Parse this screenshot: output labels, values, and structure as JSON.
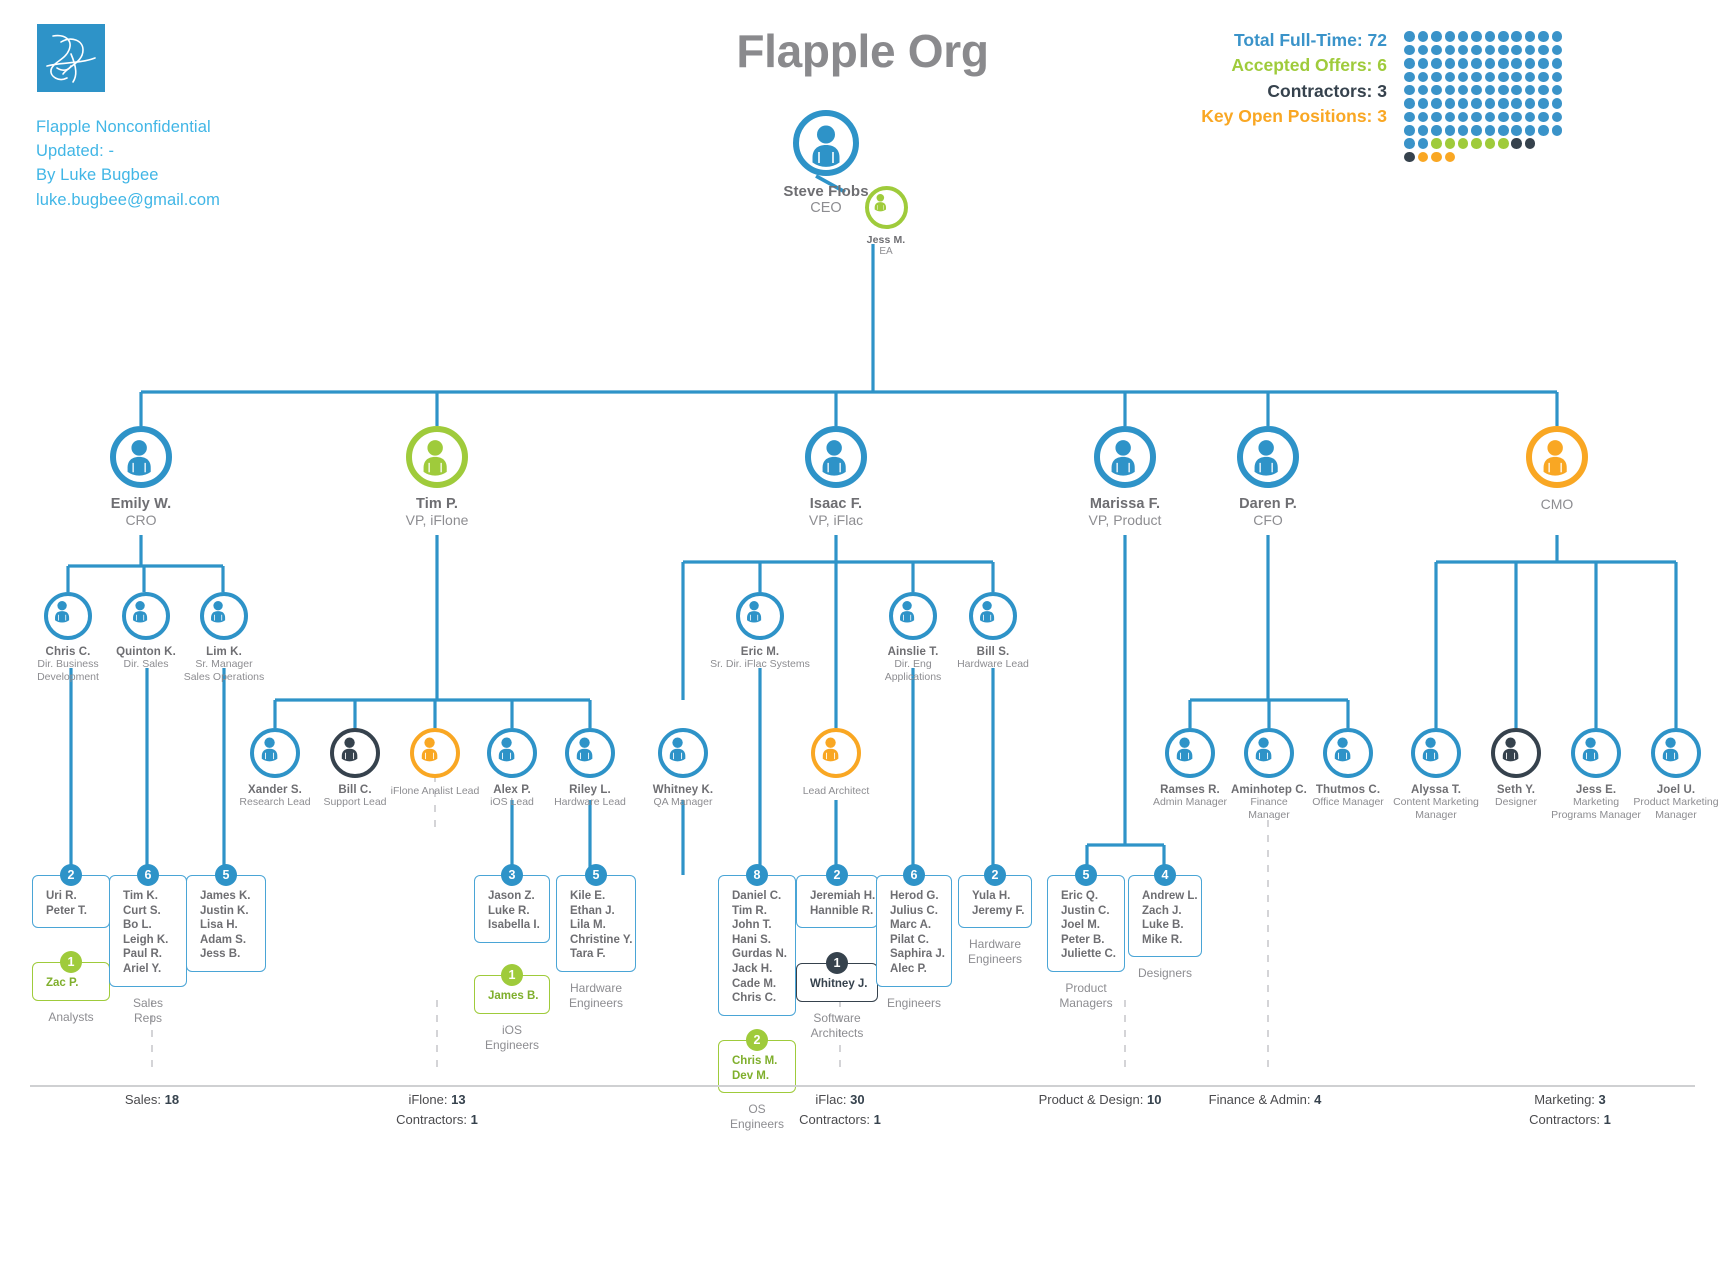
{
  "header": {
    "title": "Flapple Org",
    "logo_icon": "signature-logo",
    "meta_lines": [
      "Flapple  Nonconfidential",
      "Updated: -",
      "By Luke Bugbee",
      "luke.bugbee@gmail.com"
    ]
  },
  "stats": {
    "full_time_label": "Total Full-Time:",
    "full_time_value": "72",
    "offers_label": "Accepted Offers:",
    "offers_value": "6",
    "contractors_label": "Contractors:",
    "contractors_value": "3",
    "open_label": "Key Open Positions:",
    "open_value": "3",
    "colors": {
      "blue": "#3a93c9",
      "green": "#9fcb3b",
      "dark": "#36424d",
      "orange": "#f9a723"
    },
    "matrix": {
      "columns": 12,
      "rows": [
        [
          "blue",
          "blue",
          "blue",
          "blue",
          "blue",
          "blue",
          "blue",
          "blue",
          "blue",
          "blue",
          "blue",
          "blue"
        ],
        [
          "blue",
          "blue",
          "blue",
          "blue",
          "blue",
          "blue",
          "blue",
          "blue",
          "blue",
          "blue",
          "blue",
          "blue"
        ],
        [
          "blue",
          "blue",
          "blue",
          "blue",
          "blue",
          "blue",
          "blue",
          "blue",
          "blue",
          "blue",
          "blue",
          "blue"
        ],
        [
          "blue",
          "blue",
          "blue",
          "blue",
          "blue",
          "blue",
          "blue",
          "blue",
          "blue",
          "blue",
          "blue",
          "blue"
        ],
        [
          "blue",
          "blue",
          "blue",
          "blue",
          "blue",
          "blue",
          "blue",
          "blue",
          "blue",
          "blue",
          "blue",
          "blue"
        ],
        [
          "blue",
          "blue",
          "blue",
          "blue",
          "blue",
          "blue",
          "blue",
          "blue",
          "blue",
          "blue",
          "blue",
          "blue"
        ],
        [
          "blue",
          "blue",
          "blue",
          "blue",
          "blue",
          "blue",
          "blue",
          "blue",
          "blue",
          "blue",
          "blue",
          "blue"
        ],
        [
          "blue",
          "blue",
          "blue",
          "blue",
          "blue",
          "blue",
          "blue",
          "blue",
          "blue",
          "blue",
          "blue",
          "blue"
        ],
        [
          "blue",
          "blue",
          "green",
          "green",
          "green",
          "green",
          "green",
          "green",
          "dark",
          "dark"
        ],
        [
          "dark",
          "orange",
          "orange",
          "orange"
        ]
      ]
    }
  },
  "nodes": {
    "ceo": {
      "name": "Steve Flobs",
      "title": "CEO"
    },
    "ea": {
      "name": "Jess M.",
      "title": "EA"
    },
    "emily": {
      "name": "Emily W.",
      "title": "CRO"
    },
    "tim": {
      "name": "Tim P.",
      "title": "VP, iFlone"
    },
    "isaac": {
      "name": "Isaac F.",
      "title": "VP, iFlac"
    },
    "marissa": {
      "name": "Marissa F.",
      "title": "VP, Product"
    },
    "daren": {
      "name": "Daren P.",
      "title": "CFO"
    },
    "cmo": {
      "name": "",
      "title": "CMO"
    },
    "chris_c": {
      "name": "Chris C.",
      "title": "Dir. Business\nDevelopment"
    },
    "quinton": {
      "name": "Quinton K.",
      "title": "Dir. Sales"
    },
    "lim": {
      "name": "Lim K.",
      "title": "Sr. Manager\nSales Operations"
    },
    "xander": {
      "name": "Xander S.",
      "title": "Research Lead"
    },
    "bill_c": {
      "name": "Bill C.",
      "title": "Support Lead"
    },
    "analyst": {
      "name": "iFlone Analist Lead",
      "title": ""
    },
    "alex": {
      "name": "Alex P.",
      "title": "iOS Lead"
    },
    "riley": {
      "name": "Riley L.",
      "title": "Hardware Lead"
    },
    "eric_m": {
      "name": "Eric M.",
      "title": "Sr. Dir. iFlac Systems"
    },
    "ainslie": {
      "name": "Ainslie T.",
      "title": "Dir. Eng\nApplications"
    },
    "bill_s": {
      "name": "Bill S.",
      "title": "Hardware Lead"
    },
    "whitney_k": {
      "name": "Whitney K.",
      "title": "QA Manager"
    },
    "lead_arch": {
      "name": "Lead Architect",
      "title": ""
    },
    "ramses": {
      "name": "Ramses R.",
      "title": "Admin Manager"
    },
    "aminhotep": {
      "name": "Aminhotep C.",
      "title": "Finance\nManager"
    },
    "thutmos": {
      "name": "Thutmos C.",
      "title": "Office Manager"
    },
    "alyssa": {
      "name": "Alyssa T.",
      "title": "Content Marketing\nManager"
    },
    "seth": {
      "name": "Seth Y.",
      "title": "Designer"
    },
    "jess_e": {
      "name": "Jess E.",
      "title": "Marketing\nPrograms Manager"
    },
    "joel_u": {
      "name": "Joel U.",
      "title": "Product Marketing\nManager"
    }
  },
  "boxes": {
    "analysts": {
      "count": "2",
      "members": [
        "Uri R.",
        "Peter T."
      ],
      "caption": ""
    },
    "analysts_offer": {
      "count": "1",
      "members": [
        "Zac P."
      ],
      "caption": "Analysts"
    },
    "sales_reps": {
      "count": "6",
      "members": [
        "Tim K.",
        "Curt S.",
        "Bo L.",
        "Leigh K.",
        "Paul R.",
        "Ariel Y."
      ],
      "caption": "Sales\nReps"
    },
    "sales_ops": {
      "count": "5",
      "members": [
        "James K.",
        "Justin K.",
        "Lisa H.",
        "Adam S.",
        "Jess B."
      ],
      "caption": ""
    },
    "ios_eng": {
      "count": "3",
      "members": [
        "Jason Z.",
        "Luke R.",
        "Isabella I."
      ],
      "caption": ""
    },
    "ios_offer": {
      "count": "1",
      "members": [
        "James B."
      ],
      "caption": "iOS\nEngineers"
    },
    "hw_eng_iflone": {
      "count": "5",
      "members": [
        "Kile E.",
        "Ethan J.",
        "Lila M.",
        "Christine Y.",
        "Tara F."
      ],
      "caption": "Hardware\nEngineers"
    },
    "sw_arch": {
      "count": "8",
      "members": [
        "Daniel C.",
        "Tim R.",
        "John T.",
        "Hani S.",
        "Gurdas N.",
        "Jack H.",
        "Cade M.",
        "Chris C."
      ],
      "caption": ""
    },
    "sw_arch_2": {
      "count": "2",
      "members": [
        "Jeremiah H.",
        "Hannible R."
      ],
      "caption": ""
    },
    "sw_arch_contr": {
      "count": "1",
      "members": [
        "Whitney J."
      ],
      "caption": "Software\nArchitects"
    },
    "os_eng": {
      "count": "2",
      "members": [
        "Chris M.",
        "Dev M."
      ],
      "caption": "OS\nEngineers"
    },
    "eng_apps": {
      "count": "6",
      "members": [
        "Herod G.",
        "Julius C.",
        "Marc A.",
        "Pilat C.",
        "Saphira J.",
        "Alec P."
      ],
      "caption": "Engineers"
    },
    "hw_eng_iflac": {
      "count": "2",
      "members": [
        "Yula H.",
        "Jeremy F."
      ],
      "caption": "Hardware\nEngineers"
    },
    "product_mgrs": {
      "count": "5",
      "members": [
        "Eric Q.",
        "Justin C.",
        "Joel M.",
        "Peter B.",
        "Juliette C."
      ],
      "caption": "Product\nManagers"
    },
    "designers": {
      "count": "4",
      "members": [
        "Andrew L.",
        "Zach J.",
        "Luke B.",
        "Mike R."
      ],
      "caption": "Designers"
    }
  },
  "footer": {
    "groups": [
      {
        "line1_label": "Sales:",
        "line1_value": "18",
        "line2_label": "",
        "line2_value": ""
      },
      {
        "line1_label": "iFlone:",
        "line1_value": "13",
        "line2_label": "Contractors:",
        "line2_value": "1"
      },
      {
        "line1_label": "iFlac:",
        "line1_value": "30",
        "line2_label": "Contractors:",
        "line2_value": "1"
      },
      {
        "line1_label": "Product & Design:",
        "line1_value": "10",
        "line2_label": "",
        "line2_value": ""
      },
      {
        "line1_label": "Finance & Admin:",
        "line1_value": "4",
        "line2_label": "",
        "line2_value": ""
      },
      {
        "line1_label": "Marketing:",
        "line1_value": "3",
        "line2_label": "Contractors:",
        "line2_value": "1"
      }
    ]
  }
}
